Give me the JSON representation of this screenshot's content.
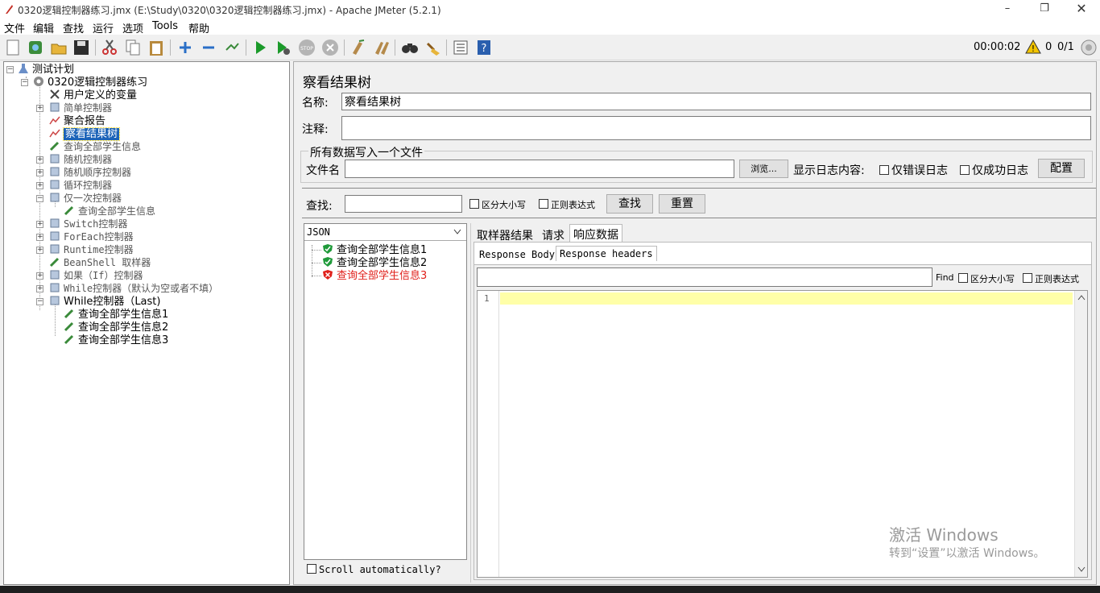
{
  "window": {
    "title": "0320逻辑控制器练习.jmx (E:\\Study\\0320\\0320逻辑控制器练习.jmx) - Apache JMeter (5.2.1)"
  },
  "menu": [
    "文件",
    "编辑",
    "查找",
    "运行",
    "选项",
    "Tools",
    "帮助"
  ],
  "status": {
    "timer": "00:00:02",
    "warnings": "0",
    "threads": "0/1"
  },
  "toolbar_icons": [
    "new-icon",
    "templates-icon",
    "open-icon",
    "save-icon",
    "cut-icon",
    "copy-icon",
    "paste-icon",
    "expand-icon",
    "collapse-icon",
    "toggle-icon",
    "start-icon",
    "start-no-pause-icon",
    "stop-icon",
    "shutdown-icon",
    "clear-icon",
    "clear-all-icon",
    "search-icon",
    "reset-search-icon",
    "function-helper-icon",
    "help-icon"
  ],
  "tree": {
    "root": "测试计划",
    "plan": "0320逻辑控制器练习",
    "items": [
      "用户定义的变量",
      "简单控制器",
      "聚合报告",
      "察看结果树",
      "查询全部学生信息",
      "随机控制器",
      "随机顺序控制器",
      "循环控制器",
      "仅一次控制器",
      "查询全部学生信息",
      "Switch控制器",
      "ForEach控制器",
      "Runtime控制器",
      "BeanShell 取样器",
      "如果（If）控制器",
      "While控制器（默认为空或者不填）",
      "While控制器（Last)",
      "查询全部学生信息1",
      "查询全部学生信息2",
      "查询全部学生信息3"
    ]
  },
  "panel": {
    "title": "察看结果树",
    "name_label": "名称:",
    "name_value": "察看结果树",
    "comment_label": "注释:",
    "comment_value": "",
    "file_group_title": "所有数据写入一个文件",
    "file_label": "文件名",
    "file_value": "",
    "browse_button": "浏览...",
    "log_label": "显示日志内容:",
    "errors_only": "仅错误日志",
    "success_only": "仅成功日志",
    "config_button": "配置",
    "search_label": "查找:",
    "search_value": "",
    "case_sensitive": "区分大小写",
    "regex": "正则表达式",
    "find_button": "查找",
    "reset_button": "重置",
    "renderer": "JSON",
    "results": [
      {
        "label": "查询全部学生信息1",
        "status": "success"
      },
      {
        "label": "查询全部学生信息2",
        "status": "success"
      },
      {
        "label": "查询全部学生信息3",
        "status": "error"
      }
    ],
    "scroll_auto": "Scroll automatically?",
    "tabs": [
      "取样器结果",
      "请求",
      "响应数据"
    ],
    "subtabs": [
      "Response Body",
      "Response headers"
    ],
    "find_label": "Find",
    "find_case": "区分大小写",
    "find_regex": "正则表达式",
    "find_value": "",
    "line_number": "1"
  },
  "watermark": {
    "line1": "激活 Windows",
    "line2": "转到“设置”以激活 Windows。"
  },
  "colors": {
    "selection": "#1c63b8",
    "error": "#e0201b",
    "success": "#1f9a3a",
    "editor_highlight": "#ffffa8"
  }
}
